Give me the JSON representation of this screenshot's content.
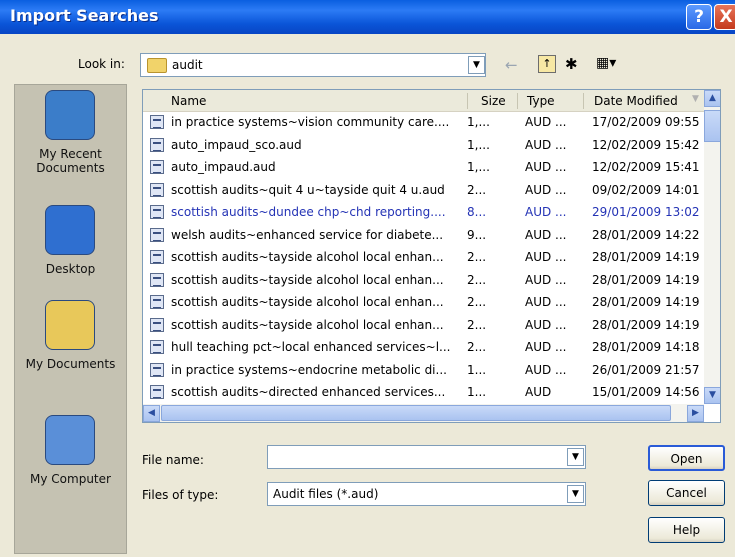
{
  "window": {
    "title": "Import Searches",
    "help_glyph": "?",
    "close_glyph": "X"
  },
  "lookin": {
    "label": "Look in:",
    "value": "audit"
  },
  "toolbar": {
    "back_glyph": "←",
    "up_glyph": "↑",
    "new_glyph": "✱",
    "view_glyph": "▦▾"
  },
  "places": [
    {
      "label": "My Recent\nDocuments",
      "icon": "recent-documents-icon",
      "color": "#3b7dc9"
    },
    {
      "label": "Desktop",
      "icon": "desktop-icon",
      "color": "#2f6fd0"
    },
    {
      "label": "My Documents",
      "icon": "my-documents-icon",
      "color": "#e8c85a"
    },
    {
      "label": "My Computer",
      "icon": "my-computer-icon",
      "color": "#5a8fd8"
    }
  ],
  "columns": {
    "name": "Name",
    "size": "Size",
    "type": "Type",
    "date": "Date Modified"
  },
  "files": [
    {
      "name": "in practice systems~vision community care....",
      "size": "1,...",
      "type": "AUD ...",
      "date": "17/02/2009 09:55"
    },
    {
      "name": "auto_impaud_sco.aud",
      "size": "1,...",
      "type": "AUD ...",
      "date": "12/02/2009 15:42"
    },
    {
      "name": "auto_impaud.aud",
      "size": "1,...",
      "type": "AUD ...",
      "date": "12/02/2009 15:41"
    },
    {
      "name": "scottish audits~quit 4 u~tayside quit 4 u.aud",
      "size": "2...",
      "type": "AUD ...",
      "date": "09/02/2009 14:01"
    },
    {
      "name": "scottish audits~dundee chp~chd reporting....",
      "size": "8...",
      "type": "AUD ...",
      "date": "29/01/2009 13:02"
    },
    {
      "name": "welsh audits~enhanced service for diabete...",
      "size": "9...",
      "type": "AUD ...",
      "date": "28/01/2009 14:22"
    },
    {
      "name": "scottish audits~tayside alcohol local enhan...",
      "size": "2...",
      "type": "AUD ...",
      "date": "28/01/2009 14:19"
    },
    {
      "name": "scottish audits~tayside alcohol local enhan...",
      "size": "2...",
      "type": "AUD ...",
      "date": "28/01/2009 14:19"
    },
    {
      "name": "scottish audits~tayside alcohol local enhan...",
      "size": "2...",
      "type": "AUD ...",
      "date": "28/01/2009 14:19"
    },
    {
      "name": "scottish audits~tayside alcohol local enhan...",
      "size": "2...",
      "type": "AUD ...",
      "date": "28/01/2009 14:19"
    },
    {
      "name": "hull teaching pct~local enhanced services~l...",
      "size": "2...",
      "type": "AUD ...",
      "date": "28/01/2009 14:18"
    },
    {
      "name": "in practice systems~endocrine metabolic di...",
      "size": "1...",
      "type": "AUD ...",
      "date": "26/01/2009 21:57"
    },
    {
      "name": "scottish audits~directed enhanced services...",
      "size": "1...",
      "type": "AUD",
      "date": "15/01/2009 14:56"
    }
  ],
  "selected_index": 4,
  "form": {
    "filename_label": "File name:",
    "filename_value": "",
    "filetype_label": "Files of type:",
    "filetype_value": "Audit files (*.aud)"
  },
  "buttons": {
    "open": "Open",
    "cancel": "Cancel",
    "help": "Help"
  }
}
